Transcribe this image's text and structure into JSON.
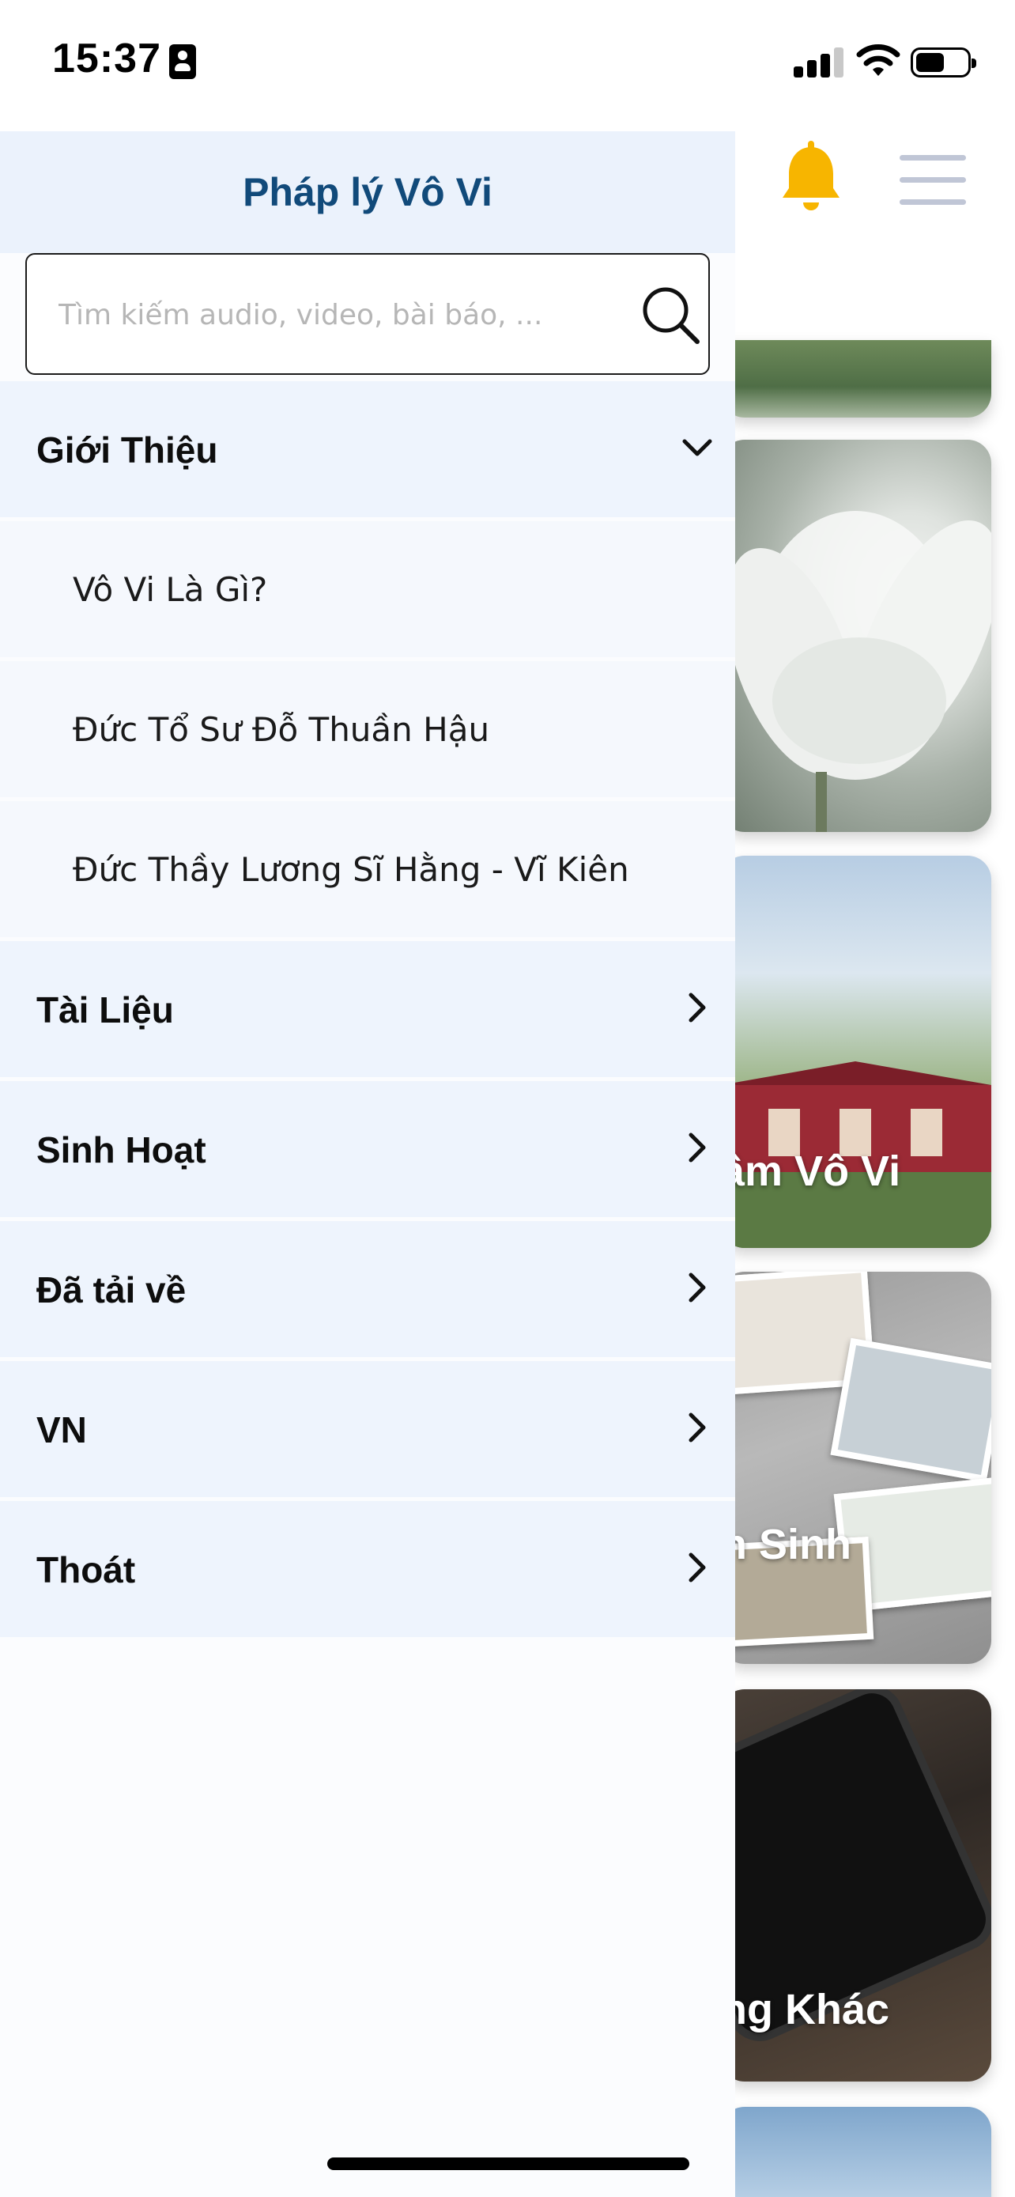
{
  "status_bar": {
    "time": "15:37",
    "battery_level": 0.55
  },
  "background_page": {
    "card_labels": [
      "âm Vô Vi",
      "h Sinh",
      "ng Khác"
    ]
  },
  "drawer": {
    "title": "Pháp lý Vô Vi",
    "search": {
      "placeholder": "Tìm kiếm audio, video, bài báo, ...",
      "value": ""
    },
    "menu": [
      {
        "label": "Giới Thiệu",
        "expanded": true,
        "icon": "chevron-down-icon"
      },
      {
        "label": "Vô Vi Là Gì?",
        "sub": true
      },
      {
        "label": "Đức Tổ Sư Đỗ Thuần Hậu",
        "sub": true
      },
      {
        "label": "Đức Thầy Lương Sĩ Hằng - Vĩ Kiên",
        "sub": true
      },
      {
        "label": "Tài Liệu",
        "icon": "chevron-right-icon"
      },
      {
        "label": "Sinh Hoạt",
        "icon": "chevron-right-icon"
      },
      {
        "label": "Đã tải về",
        "icon": "chevron-right-icon"
      },
      {
        "label": "VN",
        "icon": "chevron-right-icon"
      },
      {
        "label": "Thoát",
        "icon": "chevron-right-icon"
      }
    ]
  },
  "colors": {
    "drawer_header_bg": "#ebf2fc",
    "title_color": "#114a7a",
    "bell_color": "#f7b500",
    "menu_row_bg": "#eef4fd"
  }
}
